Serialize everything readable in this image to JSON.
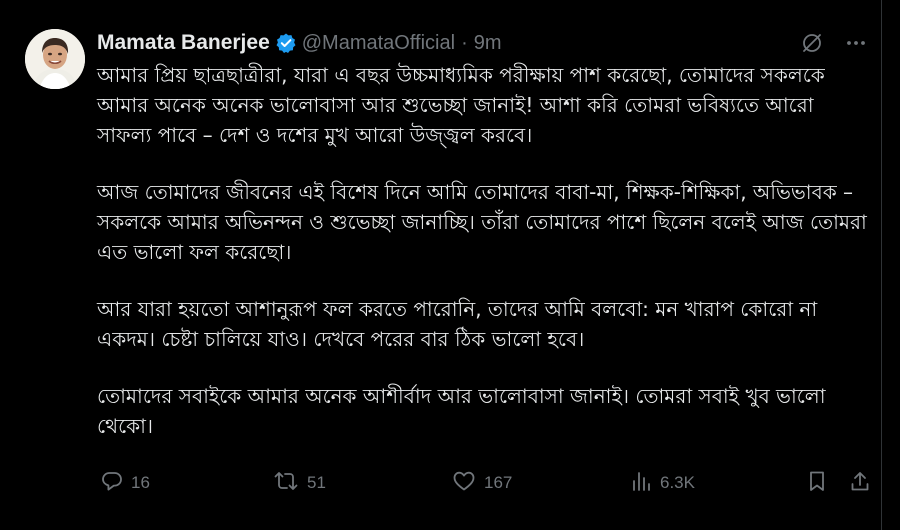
{
  "tweet": {
    "author": {
      "name": "Mamata Banerjee",
      "handle": "@MamataOfficial",
      "separator": "·",
      "time": "9m",
      "verified": true,
      "avatar_icon": "profile-photo"
    },
    "paragraphs": [
      "আমার প্রিয় ছাত্রছাত্রীরা, যারা এ বছর উচ্চমাধ্যমিক পরীক্ষায় পাশ করেছো, তোমাদের সকলকে আমার অনেক অনেক ভালোবাসা আর শুভেচ্ছা জানাই! আশা করি তোমরা ভবিষ্যতে আরো সাফল্য পাবে – দেশ ও দশের মুখ আরো উজ্জ্বল করবে।",
      "আজ তোমাদের জীবনের এই বিশেষ দিনে আমি তোমাদের বাবা-মা, শিক্ষক-শিক্ষিকা, অভিভাবক – সকলকে আমার অভিনন্দন ও শুভেচ্ছা জানাচ্ছি। তাঁরা তোমাদের পাশে ছিলেন বলেই আজ তোমরা এত ভালো ফল করেছো।",
      "আর যারা হয়তো আশানুরূপ ফল করতে পারোনি, তাদের আমি বলবো: মন খারাপ কোরো না একদম। চেষ্টা চালিয়ে যাও। দেখবে পরের বার ঠিক ভালো হবে।",
      "তোমাদের সবাইকে আমার অনেক আশীর্বাদ আর ভালোবাসা জানাই। তোমরা সবাই খুব ভালো থেকো।"
    ],
    "stats": {
      "replies": "16",
      "reposts": "51",
      "likes": "167",
      "views": "6.3K"
    }
  },
  "colors": {
    "background": "#000000",
    "text": "#e7e9ea",
    "muted": "#71767b",
    "verified": "#1d9bf0"
  },
  "icons": {
    "verified": "verified-badge-icon",
    "grok": "grok-icon",
    "more": "more-icon",
    "reply": "reply-icon",
    "repost": "repost-icon",
    "like": "heart-icon",
    "views": "views-icon",
    "bookmark": "bookmark-icon",
    "share": "share-icon"
  }
}
